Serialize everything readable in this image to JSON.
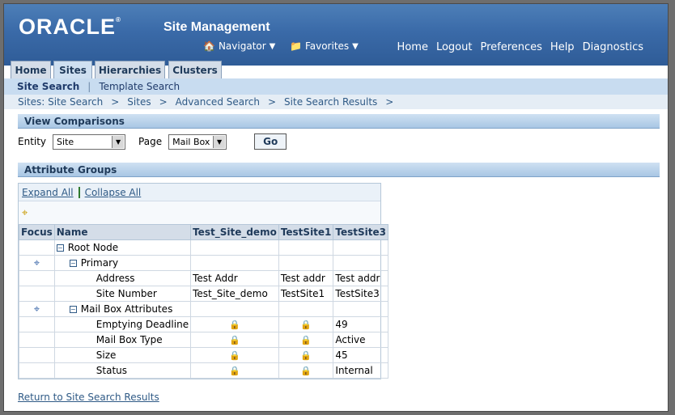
{
  "header": {
    "logo": "ORACLE",
    "app_title": "Site Management",
    "navigator": "Navigator",
    "favorites": "Favorites",
    "global_links": [
      "Home",
      "Logout",
      "Preferences",
      "Help",
      "Diagnostics"
    ]
  },
  "tabs": [
    "Home",
    "Sites",
    "Hierarchies",
    "Clusters"
  ],
  "subtabs": {
    "active": "Site Search",
    "other": "Template Search"
  },
  "breadcrumbs": [
    "Sites: Site Search",
    "Sites",
    "Advanced Search",
    "Site Search Results"
  ],
  "view_comparisons": {
    "title": "View Comparisons",
    "entity_label": "Entity",
    "entity_value": "Site",
    "page_label": "Page",
    "page_value": "Mail Box",
    "go": "Go"
  },
  "attribute_groups": {
    "title": "Attribute Groups",
    "expand_all": "Expand All",
    "collapse_all": "Collapse All",
    "columns": [
      "Focus",
      "Name",
      "Test_Site_demo",
      "TestSite1",
      "TestSite3"
    ],
    "rows": {
      "root": "Root Node",
      "primary": "Primary",
      "address": {
        "name": "Address",
        "v1": "Test Addr",
        "v2": "Test addr",
        "v3": "Test addr"
      },
      "site_number": {
        "name": "Site Number",
        "v1": "Test_Site_demo",
        "v2": "TestSite1",
        "v3": "TestSite3"
      },
      "mailbox": "Mail Box Attributes",
      "emptying": {
        "name": "Emptying Deadline",
        "v3": "49"
      },
      "mailbox_type": {
        "name": "Mail Box Type",
        "v3": "Active"
      },
      "size": {
        "name": "Size",
        "v3": "45"
      },
      "status": {
        "name": "Status",
        "v3": "Internal"
      }
    }
  },
  "footer": {
    "return_link": "Return to Site Search Results"
  }
}
